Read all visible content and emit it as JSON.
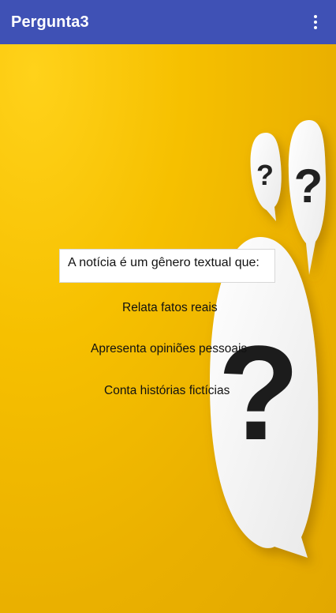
{
  "appbar": {
    "title": "Pergunta3",
    "menu_icon": "more-vert-icon",
    "color": "#3f51b5"
  },
  "background": {
    "color": "#f1b800",
    "decoration_icons": [
      "question-bubble-icon",
      "question-bubble-icon",
      "question-bubble-icon"
    ]
  },
  "question": {
    "text": "A notícia é um gênero textual que:"
  },
  "options": [
    {
      "label": "Relata fatos reais"
    },
    {
      "label": "Apresenta opiniões pessoais"
    },
    {
      "label": "Conta histórias fictícias"
    }
  ]
}
